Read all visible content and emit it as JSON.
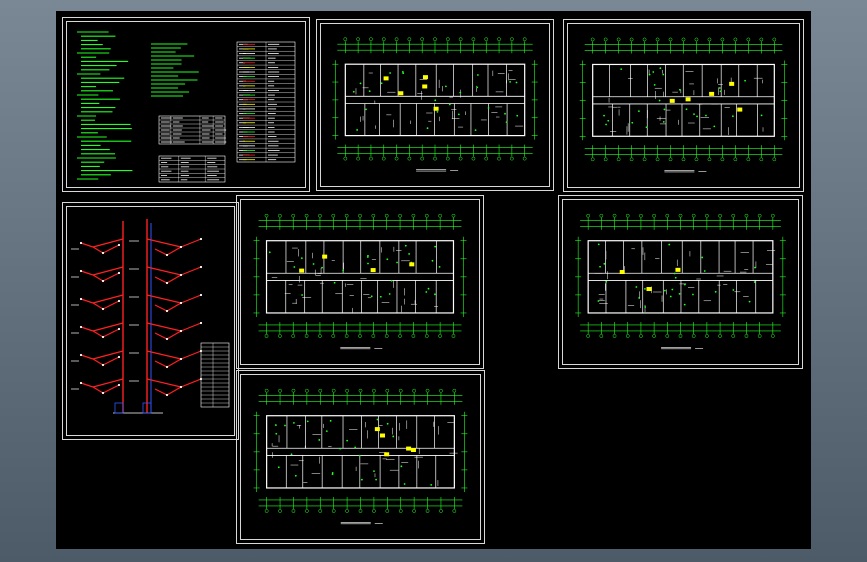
{
  "viewer": {
    "background": "#5a6878",
    "canvas_color": "#000000"
  },
  "colors": {
    "frame": "#d8d8d8",
    "wall": "#ffffff",
    "dimension": "#22ff22",
    "fixture": "#ffff00",
    "pipe_red": "#ff2020",
    "pipe_blue": "#3355ff"
  },
  "sheets": [
    {
      "id": "s1",
      "content": "design-notes-and-legend"
    },
    {
      "id": "s2",
      "content": "floor-plan"
    },
    {
      "id": "s3",
      "content": "floor-plan"
    },
    {
      "id": "s4",
      "content": "riser-system-diagram"
    },
    {
      "id": "s5",
      "content": "floor-plan"
    },
    {
      "id": "s6",
      "content": "floor-plan"
    },
    {
      "id": "s7",
      "content": "floor-plan"
    }
  ]
}
